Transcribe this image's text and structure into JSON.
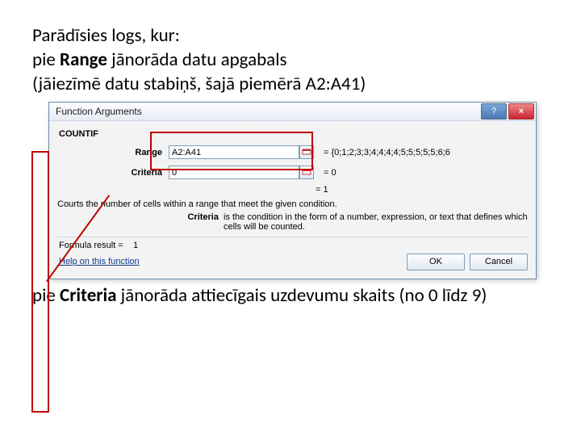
{
  "intro": {
    "line1": "Parādīsies logs, kur:",
    "line2_pre": "pie ",
    "line2_bold": "Range",
    "line2_post": " jānorāda datu apgabals",
    "line3": "(jāiezīmē datu stabiņš, šajā piemērā A2:A41)"
  },
  "dialog": {
    "title": "Function Arguments",
    "help_btn": "?",
    "close_btn": "×",
    "fn_name": "COUNTIF",
    "args": {
      "range_label": "Range",
      "range_value": "A2:A41",
      "range_result": "= {0;1;2;3;3;4;4;4;4;5;5;5;5;5;6;6",
      "criteria_label": "Criteria",
      "criteria_value": "0",
      "criteria_result": "= 0"
    },
    "overall_result": "= 1",
    "desc": "Courts the number of cells within a range that meet the given condition.",
    "criteria_desc_label": "Criteria",
    "criteria_desc_text": "is the condition in the form of a number, expression, or text that defines which cells will be counted.",
    "formula_result_label": "Formula result =",
    "formula_result_value": "1",
    "help_link": "Help on this function",
    "ok": "OK",
    "cancel": "Cancel"
  },
  "outro": {
    "pre": "pie ",
    "bold": "Criteria",
    "post": " jānorāda attiecīgais uzdevumu skaits (no 0 līdz 9)"
  }
}
